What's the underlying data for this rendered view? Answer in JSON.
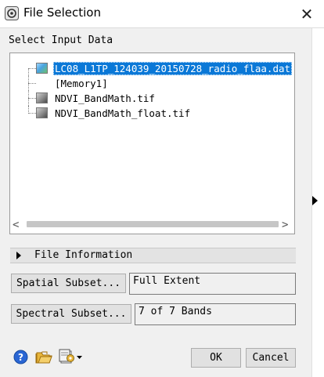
{
  "window": {
    "title": "File Selection",
    "close_glyph": "✕"
  },
  "input": {
    "label": "Select Input Data",
    "items": [
      {
        "label": "LC08_L1TP_124039_20150728_radio_flaa.dat",
        "selected": true,
        "icon": "color-raster-icon"
      },
      {
        "label": "[Memory1]",
        "selected": false,
        "icon": "none"
      },
      {
        "label": "NDVI_BandMath.tif",
        "selected": false,
        "icon": "grayscale-raster-icon"
      },
      {
        "label": "NDVI_BandMath_float.tif",
        "selected": false,
        "icon": "grayscale-raster-icon"
      }
    ],
    "scroll_left": "<",
    "scroll_right": ">"
  },
  "file_info": {
    "label": "File Information"
  },
  "spatial": {
    "button": "Spatial Subset...",
    "value": "Full Extent"
  },
  "spectral": {
    "button": "Spectral Subset...",
    "value": "7 of 7 Bands"
  },
  "footer": {
    "icons": [
      "help-icon",
      "open-folder-icon",
      "options-menu-icon"
    ],
    "ok": "OK",
    "cancel": "Cancel"
  },
  "colors": {
    "selection": "#0a78d7",
    "help_blue": "#2a66d4",
    "folder_yellow": "#e8b53a"
  }
}
